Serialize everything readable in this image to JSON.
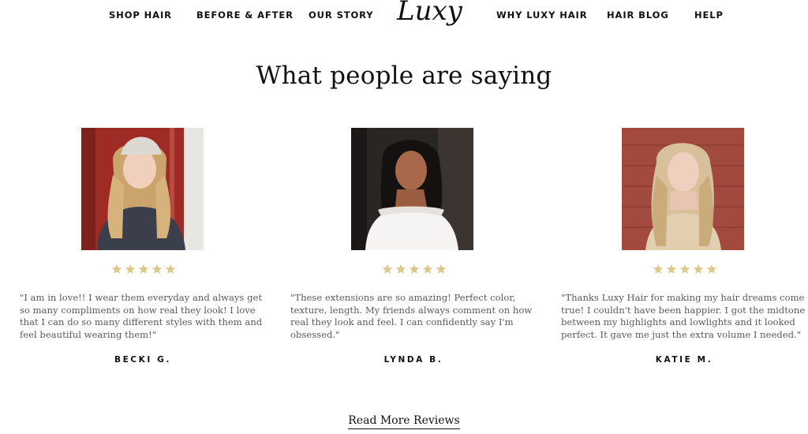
{
  "nav": {
    "items": [
      "SHOP HAIR",
      "BEFORE & AFTER",
      "OUR STORY",
      "WHY LUXY HAIR",
      "HAIR BLOG",
      "HELP"
    ],
    "logo_text": "Luxy"
  },
  "heading": "What people are saying",
  "reviews": [
    {
      "name": "BECKI G.",
      "rating": 5,
      "quote": "\"I am in love!! I wear them everyday and always get so many compliments on how real they look! I love that I can do so many different styles with them and feel beautiful wearing them!\""
    },
    {
      "name": "LYNDA B.",
      "rating": 5,
      "quote": "\"These extensions are so amazing! Perfect color, texture, length. My friends always comment on how real they look and feel. I can confidently say I'm obsessed.\""
    },
    {
      "name": "KATIE M.",
      "rating": 5,
      "quote": "\"Thanks Luxy Hair for making my hair dreams come true! I couldn't have been happier. I got the midtone between my highlights and lowlights and it looked perfect. It gave me just the extra volume I needed.\""
    }
  ],
  "read_more_label": "Read More Reviews",
  "colors": {
    "star": "#dcc98c",
    "text": "#111111",
    "quote_text": "#5a5a5a"
  }
}
